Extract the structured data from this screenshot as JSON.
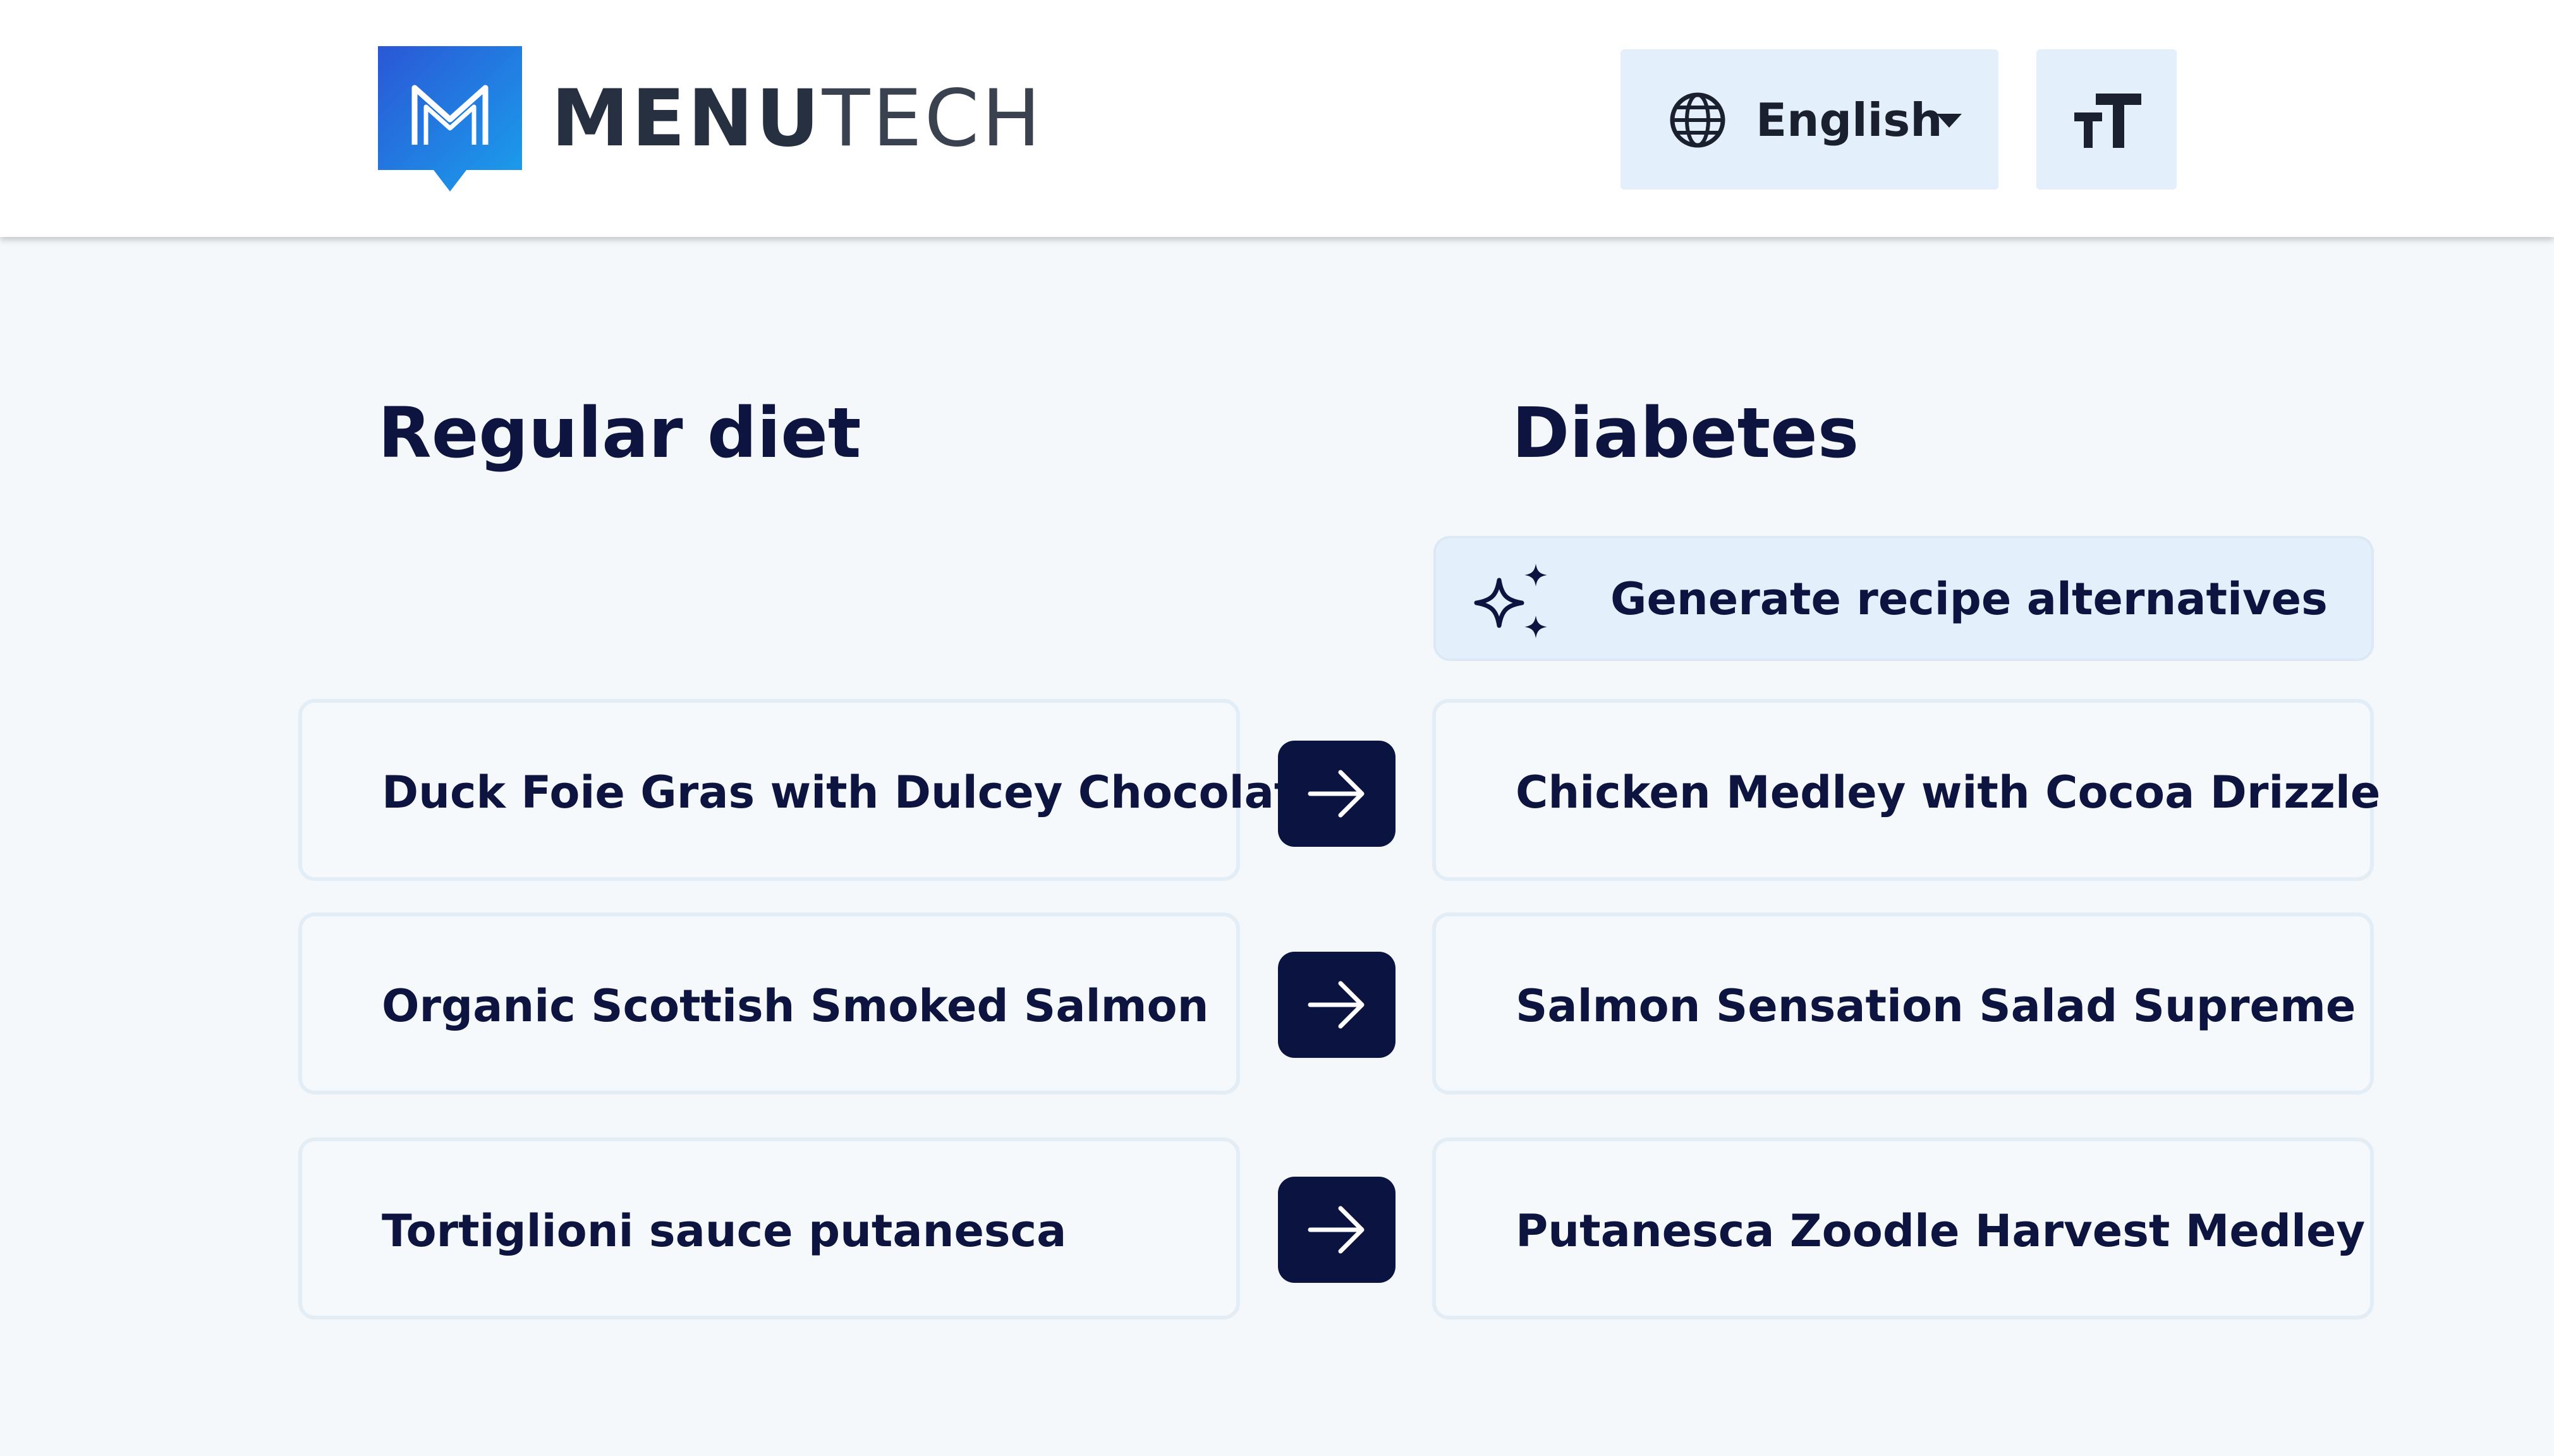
{
  "header": {
    "logo_bold": "MENU",
    "logo_light": "TECH",
    "language": {
      "label": "English",
      "icon": "globe-icon",
      "caret_icon": "caret-down-icon"
    },
    "text_size_icon": "text-size-icon"
  },
  "columns": {
    "left_title": "Regular diet",
    "right_title": "Diabetes"
  },
  "generate_button": {
    "label": "Generate recipe alternatives",
    "icon": "sparkles-icon"
  },
  "rows": [
    {
      "original": "Duck Foie Gras with Dulcey Chocolate",
      "alternative": "Chicken Medley with Cocoa Drizzle"
    },
    {
      "original": "Organic Scottish Smoked Salmon",
      "alternative": "Salmon Sensation Salad Supreme"
    },
    {
      "original": "Tortiglioni sauce putanesca",
      "alternative": "Putanesca Zoodle Harvest Medley"
    }
  ],
  "colors": {
    "page_background": "#f4f8fb",
    "header_background": "#ffffff",
    "accent_light": "#e3f0fb",
    "navy": "#0b1340",
    "logo_gradient_start": "#2a57d6",
    "logo_gradient_end": "#1aa0ec"
  }
}
